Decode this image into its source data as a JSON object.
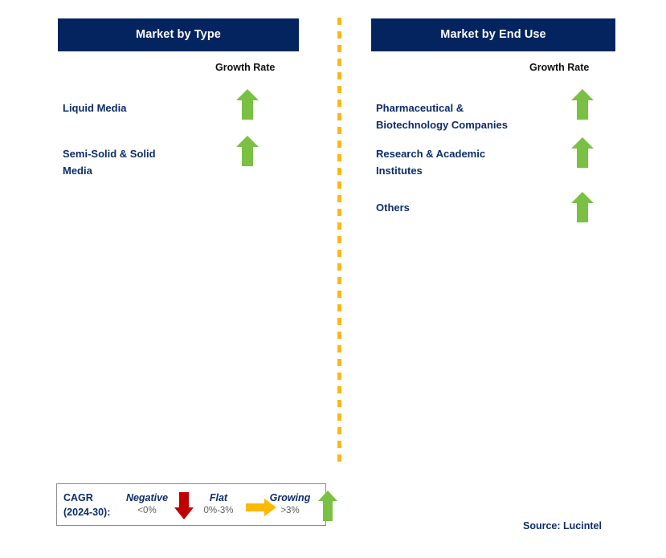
{
  "colors": {
    "header_bg": "#04245f",
    "header_text": "#ffffff",
    "label_text": "#0d2c6b",
    "arrow_green": "#7ac143",
    "arrow_red": "#c00000",
    "arrow_orange": "#fbb900",
    "divider_dash": "#fcb813",
    "legend_border": "#8d8d8d",
    "range_text": "#5d5d5d"
  },
  "panels": [
    {
      "title": "Market by Type",
      "growth_rate_header": "Growth Rate",
      "rows": [
        {
          "label": "Liquid Media",
          "growth": "growing",
          "icon": "arrow-up-icon"
        },
        {
          "label": "Semi-Solid & Solid\nMedia",
          "growth": "growing",
          "icon": "arrow-up-icon"
        }
      ]
    },
    {
      "title": "Market by End Use",
      "growth_rate_header": "Growth Rate",
      "rows": [
        {
          "label": "Pharmaceutical &\nBiotechnology Companies",
          "growth": "growing",
          "icon": "arrow-up-icon"
        },
        {
          "label": "Research & Academic\nInstitutes",
          "growth": "growing",
          "icon": "arrow-up-icon"
        },
        {
          "label": "Others",
          "growth": "growing",
          "icon": "arrow-up-icon"
        }
      ]
    }
  ],
  "legend": {
    "cagr_label": "CAGR\n(2024-30):",
    "items": [
      {
        "word": "Negative",
        "range": "<0%",
        "icon": "arrow-down-icon"
      },
      {
        "word": "Flat",
        "range": "0%-3%",
        "icon": "arrow-right-icon"
      },
      {
        "word": "Growing",
        "range": ">3%",
        "icon": "arrow-up-icon"
      }
    ]
  },
  "source": "Source: Lucintel"
}
